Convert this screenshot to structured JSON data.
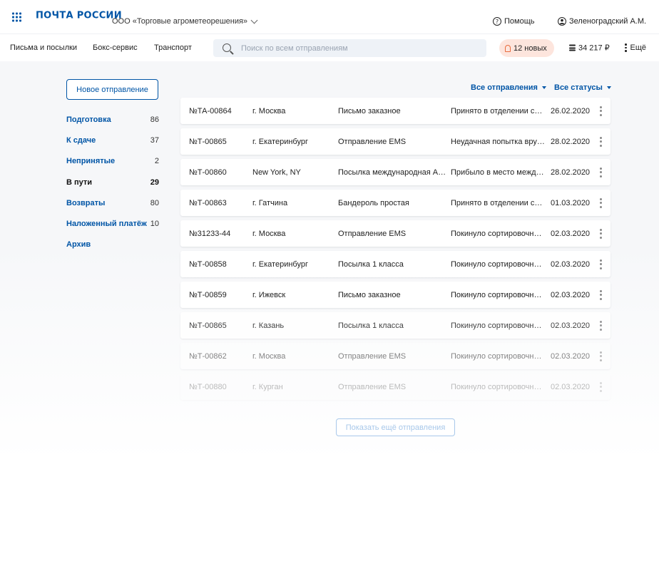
{
  "header": {
    "logo": "ПОЧТА РОССИИ",
    "organization": "ООО «Торговые агрометеорешения»",
    "help_label": "Помощь",
    "user_name": "Зеленоградский А.М."
  },
  "nav": {
    "links": [
      "Письма и посылки",
      "Бокс-сервис",
      "Транспорт"
    ],
    "search_placeholder": "Поиск по всем отправлениям",
    "notifications": "12 новых",
    "balance": "34 217 ₽",
    "more_label": "Ещё"
  },
  "sidebar": {
    "new_button": "Новое отправление",
    "items": [
      {
        "label": "Подготовка",
        "count": "86"
      },
      {
        "label": "К сдаче",
        "count": "37"
      },
      {
        "label": "Непринятые",
        "count": "2"
      },
      {
        "label": "В пути",
        "count": "29",
        "active": true
      },
      {
        "label": "Возвраты",
        "count": "80"
      },
      {
        "label": "Наложенный платёж",
        "count": "10"
      },
      {
        "label": "Архив",
        "count": ""
      }
    ]
  },
  "filters": {
    "shipments": "Все отправления",
    "statuses": "Все статусы"
  },
  "rows": [
    {
      "id": "№ТА-00864",
      "city": "г. Москва",
      "type": "Письмо заказное",
      "status": "Принято в отделении связи",
      "date": "26.02.2020"
    },
    {
      "id": "№Т-00865",
      "city": "г. Екатеринбург",
      "type": "Отправление EMS",
      "status": "Неудачная попытка вручения",
      "date": "28.02.2020"
    },
    {
      "id": "№Т-00860",
      "city": "New York, NY",
      "type": "Посылка международная АВИА",
      "status": "Прибыло в место международного обмена",
      "date": "28.02.2020"
    },
    {
      "id": "№Т-00863",
      "city": "г. Гатчина",
      "type": "Бандероль простая",
      "status": "Принято в отделении связи",
      "date": "01.03.2020"
    },
    {
      "id": "№31233-44",
      "city": "г. Москва",
      "type": "Отправление EMS",
      "status": "Покинуло сортировочный центр",
      "date": "02.03.2020"
    },
    {
      "id": "№Т-00858",
      "city": "г. Екатеринбург",
      "type": "Посылка 1 класса",
      "status": "Покинуло сортировочный центр",
      "date": "02.03.2020"
    },
    {
      "id": "№Т-00859",
      "city": "г. Ижевск",
      "type": "Письмо заказное",
      "status": "Покинуло сортировочный центр",
      "date": "02.03.2020"
    },
    {
      "id": "№Т-00865",
      "city": "г. Казань",
      "type": "Посылка 1 класса",
      "status": "Покинуло сортировочный центр",
      "date": "02.03.2020"
    },
    {
      "id": "№Т-00862",
      "city": "г. Москва",
      "type": "Отправление EMS",
      "status": "Покинуло сортировочный центр",
      "date": "02.03.2020"
    },
    {
      "id": "№Т-00880",
      "city": "г. Курган",
      "type": "Отправление EMS",
      "status": "Покинуло сортировочный центр",
      "date": "02.03.2020"
    }
  ],
  "show_more": "Показать ещё отправления"
}
